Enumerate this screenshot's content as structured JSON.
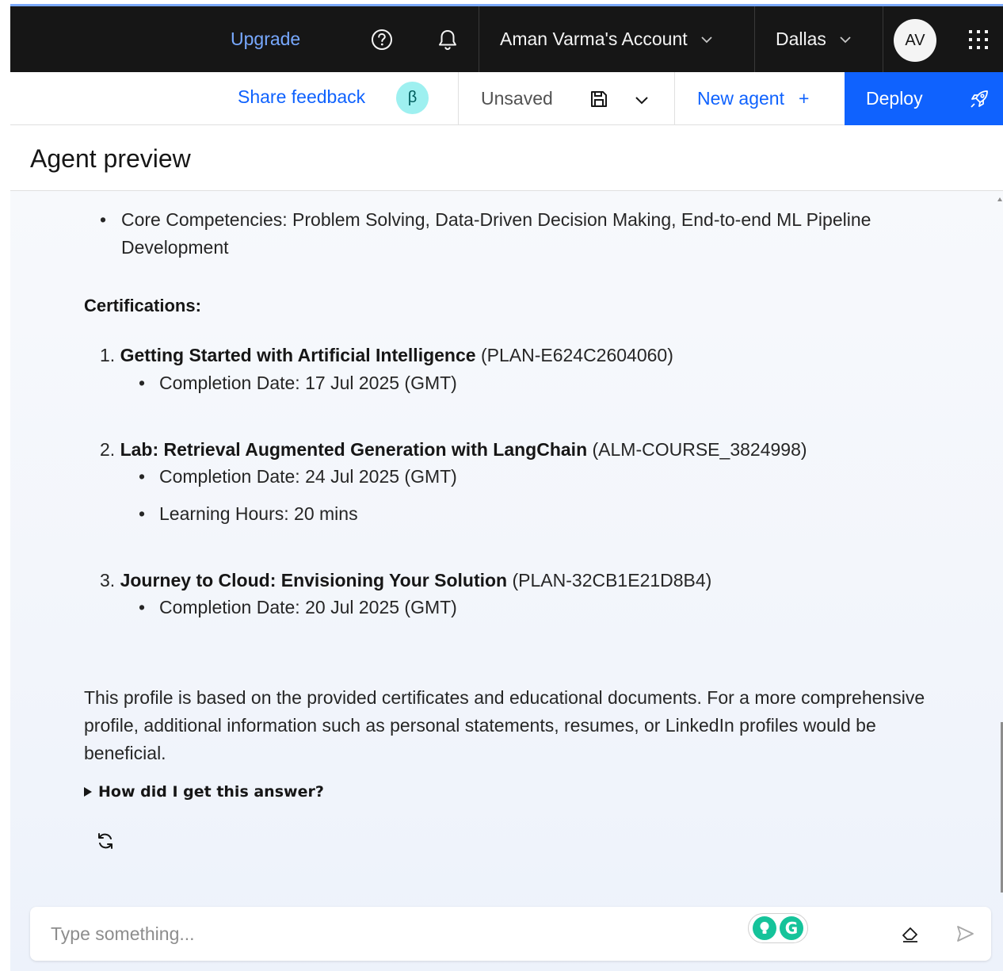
{
  "header": {
    "upgrade_label": "Upgrade",
    "account_label": "Aman Varma's Account",
    "region_label": "Dallas",
    "avatar_initials": "AV",
    "icons": [
      "help-icon",
      "notification-icon",
      "chevron-down-icon",
      "app-switcher-icon"
    ]
  },
  "toolbar": {
    "share_feedback_label": "Share feedback",
    "beta_badge": "β",
    "status_label": "Unsaved",
    "new_agent_label": "New agent",
    "new_agent_plus": "+",
    "deploy_label": "Deploy",
    "icons": [
      "save-icon",
      "chevron-down-icon",
      "rocket-icon"
    ]
  },
  "page": {
    "title": "Agent preview"
  },
  "chat": {
    "competencies": "Core Competencies: Problem Solving, Data-Driven Decision Making, End-to-end ML Pipeline Development",
    "certifications_heading": "Certifications:",
    "certifications": [
      {
        "number": "1.",
        "title": "Getting Started with Artificial Intelligence",
        "code": "(PLAN-E624C2604060)",
        "details": [
          "Completion Date: 17 Jul 2025 (GMT)"
        ]
      },
      {
        "number": "2.",
        "title": "Lab: Retrieval Augmented Generation with LangChain",
        "code": "(ALM-COURSE_3824998)",
        "details": [
          "Completion Date: 24 Jul 2025 (GMT)",
          "Learning Hours: 20 mins"
        ]
      },
      {
        "number": "3.",
        "title": "Journey to Cloud: Envisioning Your Solution",
        "code": "(PLAN-32CB1E21D8B4)",
        "details": [
          "Completion Date: 20 Jul 2025 (GMT)"
        ]
      }
    ],
    "summary": "This profile is based on the provided certificates and educational documents. For a more comprehensive profile, additional information such as personal statements, resumes, or LinkedIn profiles would be beneficial.",
    "explain_toggle": "How did I get this answer?",
    "icons": [
      "regenerate-icon"
    ]
  },
  "composer": {
    "placeholder": "Type something...",
    "grammarly_letter": "G",
    "icons": [
      "lightbulb-icon",
      "grammarly-icon",
      "eraser-icon",
      "send-icon"
    ]
  },
  "colors": {
    "header_bg": "#161616",
    "accent": "#0f62fe",
    "link": "#78a9ff",
    "beta_bg": "#9ef0f0",
    "grammarly": "#15c39a"
  }
}
